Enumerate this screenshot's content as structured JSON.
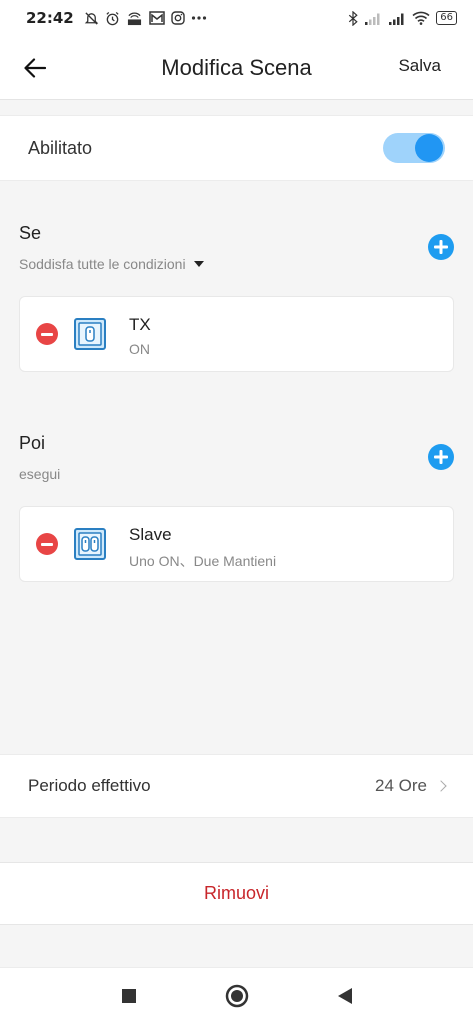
{
  "statusbar": {
    "time": "22:42",
    "icons_left": [
      "muted-bell-icon",
      "alarm-icon",
      "hd-data-icon",
      "mail-icon",
      "instagram-icon",
      "more-dots-icon"
    ],
    "icons_right": [
      "bluetooth-icon",
      "signal-icon",
      "signal-icon",
      "wifi-icon"
    ],
    "battery": "66"
  },
  "header": {
    "back_icon": "arrow-left-icon",
    "title": "Modifica Scena",
    "save_label": "Salva"
  },
  "enable": {
    "label": "Abilitato",
    "toggle_on": true,
    "accent": "#2196f3"
  },
  "if_section": {
    "title": "Se",
    "subtitle": "Soddisfa tutte le condizioni",
    "add_icon": "plus-circle-icon",
    "items": [
      {
        "name": "TX",
        "state": "ON",
        "icon": "single-switch-icon"
      }
    ]
  },
  "then_section": {
    "title": "Poi",
    "subtitle": "esegui",
    "add_icon": "plus-circle-icon",
    "items": [
      {
        "name": "Slave",
        "state": "Uno ON、Due Mantieni",
        "icon": "double-switch-icon"
      }
    ]
  },
  "period": {
    "label": "Periodo effettivo",
    "value": "24 Ore"
  },
  "remove": {
    "label": "Rimuovi",
    "color": "#c8262b"
  },
  "navbar": {
    "icons": [
      "square-recents-icon",
      "circle-home-icon",
      "triangle-back-icon"
    ]
  }
}
